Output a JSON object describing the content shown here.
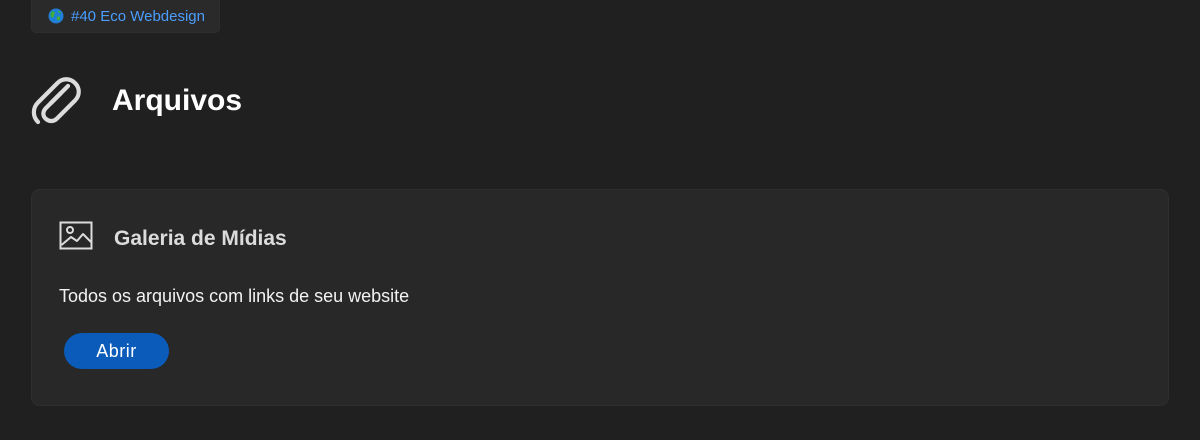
{
  "tag": {
    "label": "#40 Eco Webdesign",
    "icon": "globe-icon",
    "color": "#4a9eff"
  },
  "header": {
    "icon": "paperclip-icon",
    "title": "Arquivos"
  },
  "card": {
    "icon": "image-icon",
    "title": "Galeria de Mídias",
    "description": "Todos os arquivos com links de seu website",
    "button_label": "Abrir",
    "button_color": "#0b5cba"
  },
  "colors": {
    "background": "#202020",
    "card_background": "#282828",
    "accent": "#0b5cba"
  }
}
